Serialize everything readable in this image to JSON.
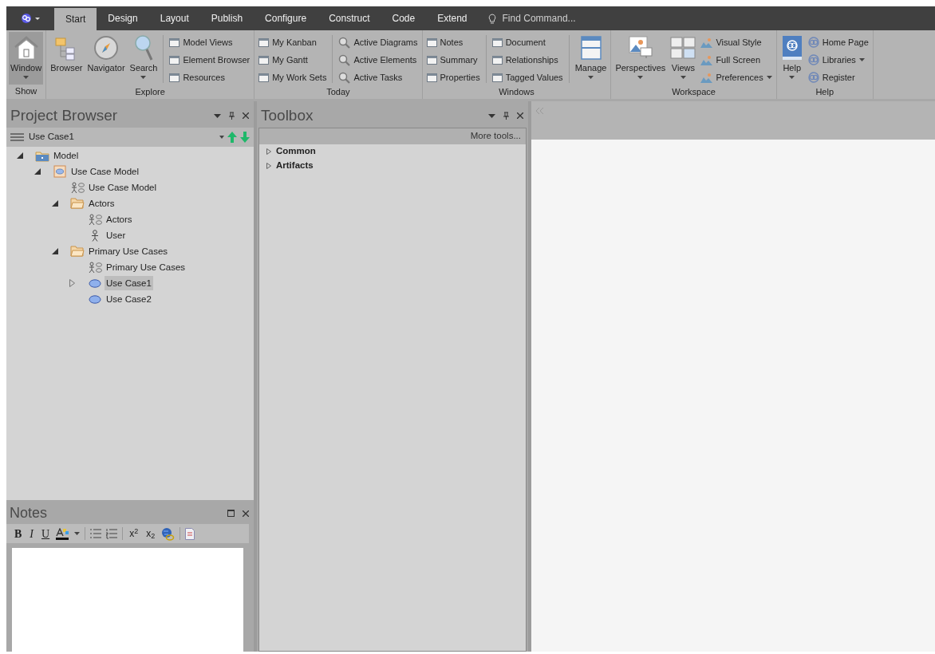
{
  "ribbon": {
    "tabs": [
      {
        "label": "Start",
        "selected": true
      },
      {
        "label": "Design",
        "selected": false
      },
      {
        "label": "Layout",
        "selected": false
      },
      {
        "label": "Publish",
        "selected": false
      },
      {
        "label": "Configure",
        "selected": false
      },
      {
        "label": "Construct",
        "selected": false
      },
      {
        "label": "Code",
        "selected": false
      },
      {
        "label": "Extend",
        "selected": false
      }
    ],
    "find_command": {
      "placeholder": "Find Command..."
    },
    "groups": [
      {
        "label": "Show",
        "blocks": [
          {
            "kind": "large",
            "divider_before": false,
            "items": [
              {
                "label": "Window",
                "kind": "home",
                "dropdown": true,
                "pressed": true
              }
            ]
          }
        ]
      },
      {
        "label": "Explore",
        "blocks": [
          {
            "kind": "large",
            "divider_before": false,
            "items": [
              {
                "label": "Browser",
                "kind": "folders",
                "dropdown": false,
                "pressed": false
              },
              {
                "label": "Navigator",
                "kind": "compass",
                "dropdown": false,
                "pressed": false
              },
              {
                "label": "Search",
                "kind": "magnifier",
                "dropdown": true,
                "pressed": false
              }
            ]
          },
          {
            "kind": "stack",
            "divider_before": true,
            "items": [
              {
                "label": "Model Views",
                "kind": "pane",
                "dropdown": false,
                "pressed": false
              },
              {
                "label": "Element Browser",
                "kind": "pane",
                "dropdown": false,
                "pressed": false
              },
              {
                "label": "Resources",
                "kind": "pane",
                "dropdown": false,
                "pressed": false
              }
            ]
          }
        ]
      },
      {
        "label": "Today",
        "blocks": [
          {
            "kind": "stack",
            "divider_before": false,
            "items": [
              {
                "label": "My Kanban",
                "kind": "pane",
                "dropdown": false,
                "pressed": false
              },
              {
                "label": "My Gantt",
                "kind": "pane",
                "dropdown": false,
                "pressed": false
              },
              {
                "label": "My Work Sets",
                "kind": "pane",
                "dropdown": false,
                "pressed": false
              }
            ]
          },
          {
            "kind": "stack",
            "divider_before": true,
            "items": [
              {
                "label": "Active Diagrams",
                "kind": "lens",
                "dropdown": false,
                "pressed": false
              },
              {
                "label": "Active Elements",
                "kind": "lens",
                "dropdown": false,
                "pressed": false
              },
              {
                "label": "Active Tasks",
                "kind": "lens",
                "dropdown": false,
                "pressed": false
              }
            ]
          }
        ]
      },
      {
        "label": "Windows",
        "blocks": [
          {
            "kind": "stack",
            "divider_before": false,
            "items": [
              {
                "label": "Notes",
                "kind": "pane",
                "dropdown": false,
                "pressed": false
              },
              {
                "label": "Summary",
                "kind": "pane",
                "dropdown": false,
                "pressed": false
              },
              {
                "label": "Properties",
                "kind": "pane",
                "dropdown": false,
                "pressed": false
              }
            ]
          },
          {
            "kind": "stack",
            "divider_before": true,
            "items": [
              {
                "label": "Document",
                "kind": "pane",
                "dropdown": false,
                "pressed": false
              },
              {
                "label": "Relationships",
                "kind": "pane",
                "dropdown": false,
                "pressed": false
              },
              {
                "label": "Tagged Values",
                "kind": "pane",
                "dropdown": false,
                "pressed": false
              }
            ]
          },
          {
            "kind": "large",
            "divider_before": true,
            "items": [
              {
                "label": "Manage",
                "kind": "panel",
                "dropdown": true,
                "pressed": false
              }
            ]
          }
        ]
      },
      {
        "label": "Workspace",
        "blocks": [
          {
            "kind": "large",
            "divider_before": false,
            "items": [
              {
                "label": "Perspectives",
                "kind": "perspectives",
                "dropdown": true,
                "pressed": false
              },
              {
                "label": "Views",
                "kind": "grid",
                "dropdown": true,
                "pressed": false
              }
            ]
          },
          {
            "kind": "stack",
            "divider_before": false,
            "items": [
              {
                "label": "Visual Style",
                "kind": "scenery",
                "dropdown": false,
                "pressed": false
              },
              {
                "label": "Full Screen",
                "kind": "scenery",
                "dropdown": false,
                "pressed": false
              },
              {
                "label": "Preferences",
                "kind": "scenery",
                "dropdown": true,
                "pressed": false
              }
            ]
          }
        ]
      },
      {
        "label": "Help",
        "blocks": [
          {
            "kind": "large",
            "divider_before": false,
            "items": [
              {
                "label": "Help",
                "kind": "book",
                "dropdown": true,
                "pressed": false
              }
            ]
          },
          {
            "kind": "stack",
            "divider_before": false,
            "items": [
              {
                "label": "Home Page",
                "kind": "emblem",
                "dropdown": false,
                "pressed": false
              },
              {
                "label": "Libraries",
                "kind": "emblem",
                "dropdown": true,
                "pressed": false
              },
              {
                "label": "Register",
                "kind": "emblem",
                "dropdown": false,
                "pressed": false
              }
            ]
          }
        ]
      }
    ]
  },
  "project_browser": {
    "title": "Project Browser",
    "current": "Use Case1",
    "tree": [
      {
        "label": "Model",
        "kind": "root",
        "expanded": true,
        "selected": false,
        "children": [
          {
            "label": "Use Case Model",
            "kind": "package",
            "expanded": true,
            "selected": false,
            "children": [
              {
                "label": "Use Case Model",
                "kind": "diagram",
                "selected": false
              },
              {
                "label": "Actors",
                "kind": "folder",
                "expanded": true,
                "selected": false,
                "children": [
                  {
                    "label": "Actors",
                    "kind": "diagram",
                    "selected": false
                  },
                  {
                    "label": "User",
                    "kind": "actor",
                    "selected": false
                  }
                ]
              },
              {
                "label": "Primary Use Cases",
                "kind": "folder",
                "expanded": true,
                "selected": false,
                "children": [
                  {
                    "label": "Primary Use Cases",
                    "kind": "diagram",
                    "selected": false
                  },
                  {
                    "label": "Use Case1",
                    "kind": "usecase",
                    "expanded": false,
                    "selected": true
                  },
                  {
                    "label": "Use Case2",
                    "kind": "usecase",
                    "selected": false
                  }
                ]
              }
            ]
          }
        ]
      }
    ]
  },
  "toolbox": {
    "title": "Toolbox",
    "more_tools": "More tools...",
    "sections": [
      {
        "label": "Common",
        "expanded": false
      },
      {
        "label": "Artifacts",
        "expanded": false
      }
    ]
  },
  "notes": {
    "title": "Notes",
    "format_buttons": [
      "B",
      "I",
      "U"
    ],
    "script_buttons": [
      "x$^{2}$",
      "x$_{2}$"
    ]
  }
}
